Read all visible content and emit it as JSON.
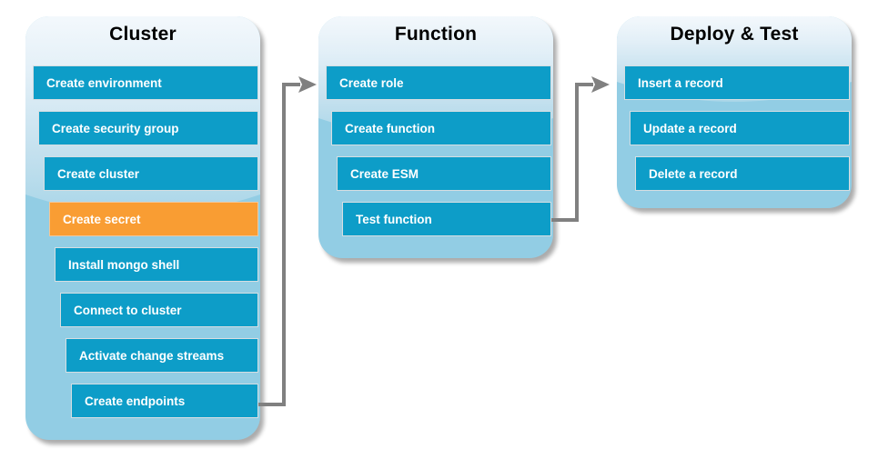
{
  "diagram": {
    "title": "Cluster / Function / Deploy & Test workflow",
    "colors": {
      "panel_fill": "#92CDE4",
      "panel_gloss_top": "#EEF5FA",
      "step_blue": "#0D9DC8",
      "step_highlight_orange": "#F99D33",
      "step_text": "#FFFFFF",
      "title_text": "#000000",
      "connector": "#808080",
      "background": "#FFFFFF"
    }
  },
  "panels": [
    {
      "id": "cluster",
      "title": "Cluster",
      "steps": [
        {
          "label": "Create environment",
          "state": "normal"
        },
        {
          "label": "Create security group",
          "state": "normal"
        },
        {
          "label": "Create cluster",
          "state": "normal"
        },
        {
          "label": "Create secret",
          "state": "highlight"
        },
        {
          "label": "Install mongo shell",
          "state": "normal"
        },
        {
          "label": "Connect to cluster",
          "state": "normal"
        },
        {
          "label": "Activate change streams",
          "state": "normal"
        },
        {
          "label": "Create endpoints",
          "state": "normal"
        }
      ]
    },
    {
      "id": "function",
      "title": "Function",
      "steps": [
        {
          "label": "Create role",
          "state": "normal"
        },
        {
          "label": "Create function",
          "state": "normal"
        },
        {
          "label": "Create ESM",
          "state": "normal"
        },
        {
          "label": "Test function",
          "state": "normal"
        }
      ]
    },
    {
      "id": "deploy-test",
      "title": "Deploy & Test",
      "steps": [
        {
          "label": "Insert a record",
          "state": "normal"
        },
        {
          "label": "Update a record",
          "state": "normal"
        },
        {
          "label": "Delete a record",
          "state": "normal"
        }
      ]
    }
  ],
  "connectors": [
    {
      "id": "cluster-to-function",
      "from": "Create endpoints",
      "to": "Create role"
    },
    {
      "id": "function-to-deploy",
      "from": "Test function",
      "to": "Insert a record"
    }
  ]
}
